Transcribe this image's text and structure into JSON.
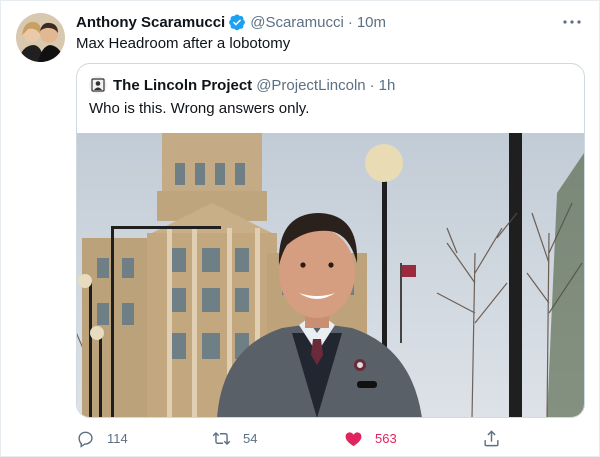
{
  "tweet": {
    "author_name": "Anthony Scaramucci",
    "author_handle": "@Scaramucci",
    "separator": "·",
    "time": "10m",
    "text": "Max Headroom after a lobotomy"
  },
  "quoted_tweet": {
    "author_name": "The Lincoln Project",
    "author_handle": "@ProjectLincoln",
    "separator": "·",
    "time": "1h",
    "text": "Who is this. Wrong answers only."
  },
  "actions": {
    "reply_count": "114",
    "retweet_count": "54",
    "like_count": "563"
  },
  "colors": {
    "verified_blue": "#1da1f2",
    "like_red": "#e0245e",
    "muted_text": "#5b7083"
  },
  "icons": [
    "verified-icon",
    "more-icon",
    "reply-icon",
    "retweet-icon",
    "like-icon",
    "share-icon"
  ]
}
